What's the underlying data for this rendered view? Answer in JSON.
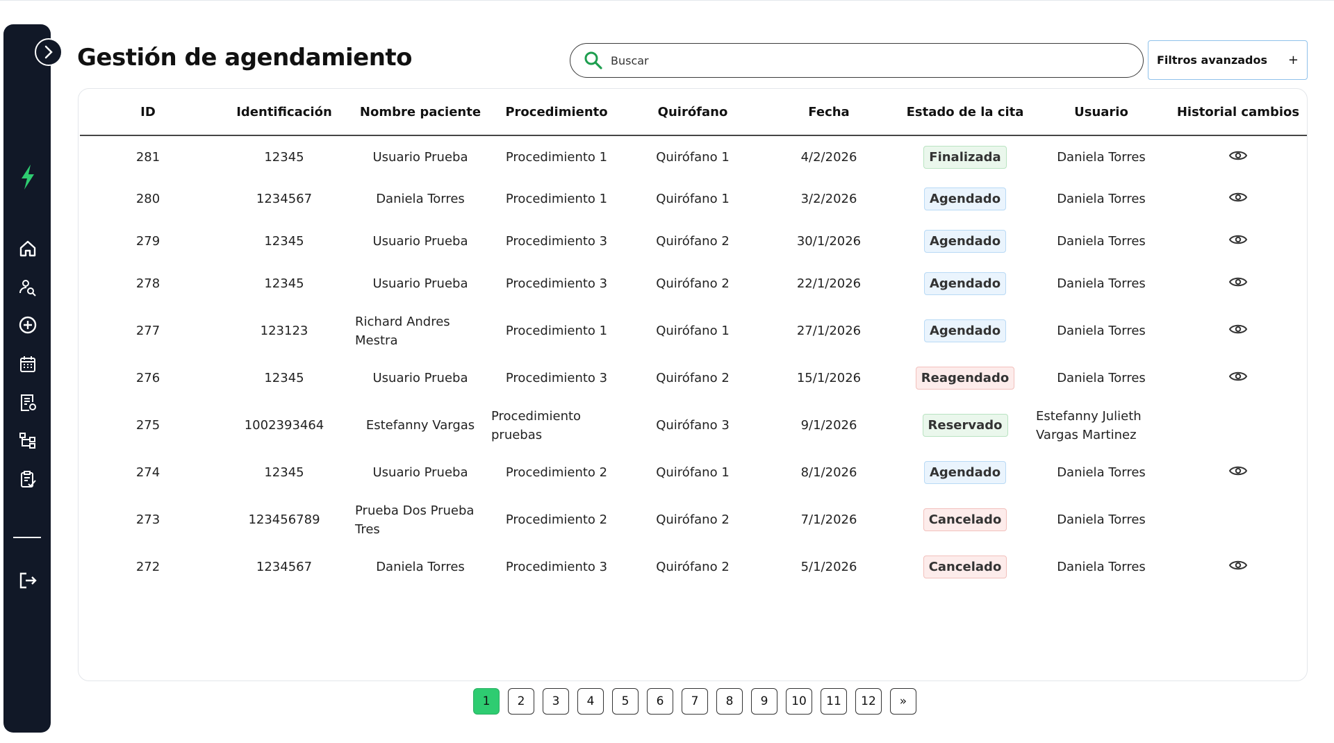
{
  "header": {
    "title": "Gestión de agendamiento",
    "search_placeholder": "Buscar",
    "filters_label": "Filtros avanzados",
    "filters_icon": "+"
  },
  "sidebar": {
    "items": [
      {
        "name": "home-icon"
      },
      {
        "name": "user-search-icon"
      },
      {
        "name": "add-circle-icon"
      },
      {
        "name": "calendar-icon"
      },
      {
        "name": "document-settings-icon"
      },
      {
        "name": "hierarchy-icon"
      },
      {
        "name": "clipboard-check-icon"
      },
      {
        "name": "logout-icon"
      }
    ],
    "accent": "#2ecc71"
  },
  "table": {
    "columns": [
      "ID",
      "Identificación",
      "Nombre paciente",
      "Procedimiento",
      "Quirófano",
      "Fecha",
      "Estado de la cita",
      "Usuario",
      "Historial cambios"
    ],
    "rows": [
      {
        "id": "281",
        "identificacion": "12345",
        "nombre": "Usuario Prueba",
        "procedimiento": "Procedimiento 1",
        "quirofano": "Quirófano 1",
        "fecha": "4/2/2026",
        "estado": "Finalizada",
        "estado_color": "green",
        "usuario": "Daniela Torres",
        "historial": true
      },
      {
        "id": "280",
        "identificacion": "1234567",
        "nombre": "Daniela Torres",
        "procedimiento": "Procedimiento 1",
        "quirofano": "Quirófano 1",
        "fecha": "3/2/2026",
        "estado": "Agendado",
        "estado_color": "blue",
        "usuario": "Daniela Torres",
        "historial": true
      },
      {
        "id": "279",
        "identificacion": "12345",
        "nombre": "Usuario Prueba",
        "procedimiento": "Procedimiento 3",
        "quirofano": "Quirófano 2",
        "fecha": "30/1/2026",
        "estado": "Agendado",
        "estado_color": "blue",
        "usuario": "Daniela Torres",
        "historial": true
      },
      {
        "id": "278",
        "identificacion": "12345",
        "nombre": "Usuario Prueba",
        "procedimiento": "Procedimiento 3",
        "quirofano": "Quirófano 2",
        "fecha": "22/1/2026",
        "estado": "Agendado",
        "estado_color": "blue",
        "usuario": "Daniela Torres",
        "historial": true
      },
      {
        "id": "277",
        "identificacion": "123123",
        "nombre": "Richard Andres Mestra",
        "procedimiento": "Procedimiento 1",
        "quirofano": "Quirófano 1",
        "fecha": "27/1/2026",
        "estado": "Agendado",
        "estado_color": "blue",
        "usuario": "Daniela Torres",
        "historial": true
      },
      {
        "id": "276",
        "identificacion": "12345",
        "nombre": "Usuario Prueba",
        "procedimiento": "Procedimiento 3",
        "quirofano": "Quirófano 2",
        "fecha": "15/1/2026",
        "estado": "Reagendado",
        "estado_color": "red",
        "usuario": "Daniela Torres",
        "historial": true
      },
      {
        "id": "275",
        "identificacion": "1002393464",
        "nombre": "Estefanny Vargas",
        "procedimiento": "Procedimiento pruebas",
        "quirofano": "Quirófano 3",
        "fecha": "9/1/2026",
        "estado": "Reservado",
        "estado_color": "green",
        "usuario": "Estefanny Julieth Vargas Martinez",
        "historial": false
      },
      {
        "id": "274",
        "identificacion": "12345",
        "nombre": "Usuario Prueba",
        "procedimiento": "Procedimiento 2",
        "quirofano": "Quirófano 1",
        "fecha": "8/1/2026",
        "estado": "Agendado",
        "estado_color": "blue",
        "usuario": "Daniela Torres",
        "historial": true
      },
      {
        "id": "273",
        "identificacion": "123456789",
        "nombre": "Prueba Dos Prueba Tres",
        "procedimiento": "Procedimiento 2",
        "quirofano": "Quirófano 2",
        "fecha": "7/1/2026",
        "estado": "Cancelado",
        "estado_color": "red",
        "usuario": "Daniela Torres",
        "historial": false
      },
      {
        "id": "272",
        "identificacion": "1234567",
        "nombre": "Daniela Torres",
        "procedimiento": "Procedimiento 3",
        "quirofano": "Quirófano 2",
        "fecha": "5/1/2026",
        "estado": "Cancelado",
        "estado_color": "red",
        "usuario": "Daniela Torres",
        "historial": true
      }
    ]
  },
  "pagination": {
    "pages": [
      "1",
      "2",
      "3",
      "4",
      "5",
      "6",
      "7",
      "8",
      "9",
      "10",
      "11",
      "12",
      "»"
    ],
    "current": "1"
  }
}
